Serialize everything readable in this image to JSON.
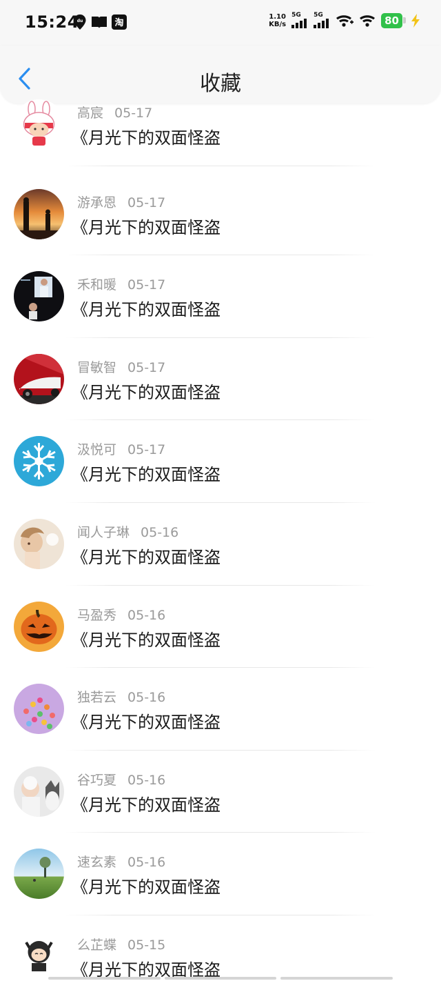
{
  "status_bar": {
    "time": "15:24",
    "icons": [
      "du-location-icon",
      "book-icon",
      "taobao-icon"
    ],
    "net_speed": "1.10",
    "net_unit": "KB/s",
    "sim1": "5G",
    "sim2": "5G",
    "battery": "80"
  },
  "header": {
    "title": "收藏"
  },
  "items": [
    {
      "name": "高宸",
      "date": "05-17",
      "book": "《月光下的双面怪盗"
    },
    {
      "name": "游承恩",
      "date": "05-17",
      "book": "《月光下的双面怪盗"
    },
    {
      "name": "禾和暖",
      "date": "05-17",
      "book": "《月光下的双面怪盗"
    },
    {
      "name": "冒敏智",
      "date": "05-17",
      "book": "《月光下的双面怪盗"
    },
    {
      "name": "汲悦可",
      "date": "05-17",
      "book": "《月光下的双面怪盗"
    },
    {
      "name": "闻人子琳",
      "date": "05-16",
      "book": "《月光下的双面怪盗"
    },
    {
      "name": "马盈秀",
      "date": "05-16",
      "book": "《月光下的双面怪盗"
    },
    {
      "name": "独若云",
      "date": "05-16",
      "book": "《月光下的双面怪盗"
    },
    {
      "name": "谷巧夏",
      "date": "05-16",
      "book": "《月光下的双面怪盗"
    },
    {
      "name": "速玄素",
      "date": "05-16",
      "book": "《月光下的双面怪盗"
    },
    {
      "name": "么芷蝶",
      "date": "05-15",
      "book": "《月光下的双面怪盗"
    }
  ],
  "colors": {
    "accent": "#2a8ef0",
    "name_text": "#9a9a9a",
    "book_text": "#1a1a1a",
    "battery": "#31c14a"
  }
}
